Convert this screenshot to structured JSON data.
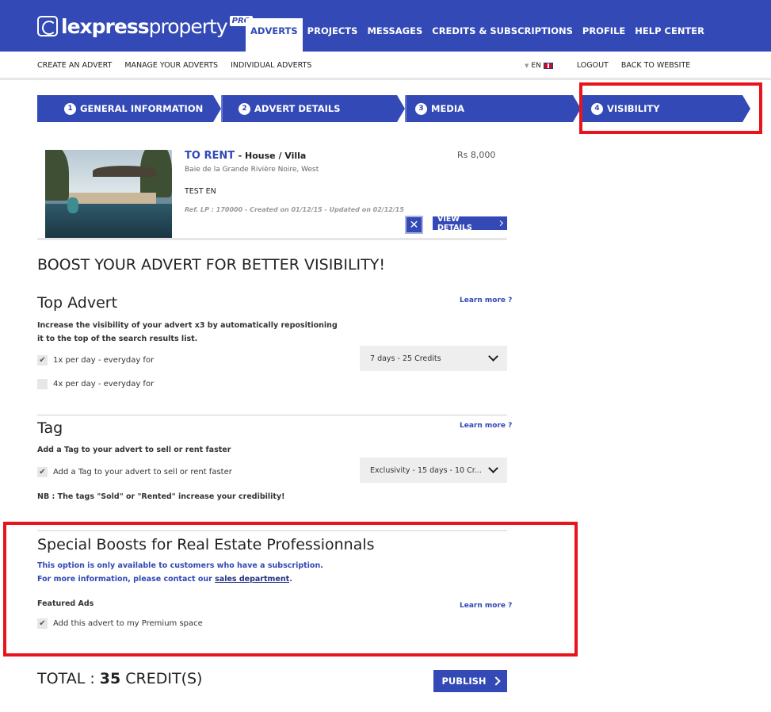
{
  "brand": {
    "logo_bold": "lexpress",
    "logo_light": "property",
    "logo_badge": "PRO"
  },
  "main_nav": [
    {
      "label": "ADVERTS",
      "active": true
    },
    {
      "label": "PROJECTS",
      "active": false
    },
    {
      "label": "MESSAGES",
      "active": false
    },
    {
      "label": "CREDITS & SUBSCRIPTIONS",
      "active": false
    },
    {
      "label": "PROFILE",
      "active": false
    },
    {
      "label": "HELP CENTER",
      "active": false
    }
  ],
  "sub_nav": {
    "left": [
      "CREATE AN ADVERT",
      "MANAGE YOUR ADVERTS",
      "INDIVIDUAL ADVERTS"
    ],
    "lang": "EN",
    "right": [
      "LOGOUT",
      "BACK TO WEBSITE"
    ]
  },
  "steps": [
    {
      "num": "1",
      "label": "GENERAL INFORMATION"
    },
    {
      "num": "2",
      "label": "ADVERT DETAILS"
    },
    {
      "num": "3",
      "label": "MEDIA"
    },
    {
      "num": "4",
      "label": "VISIBILITY"
    }
  ],
  "listing": {
    "transaction": "TO RENT",
    "kind": "- House / Villa",
    "location": "Baie de la Grande Rivière Noire, West",
    "title": "TEST EN",
    "ref": "Ref. LP : 170000 - Created on 01/12/15 - Updated on 02/12/15",
    "price": "Rs 8,000",
    "delete_glyph": "✕",
    "view_label": "VIEW DETAILS"
  },
  "boost_heading": "BOOST YOUR ADVERT FOR BETTER VISIBILITY!",
  "top_advert": {
    "title": "Top Advert",
    "learn_more": "Learn more ?",
    "desc_line1": "Increase the visibility of your advert x3 by automatically repositioning",
    "desc_line2": "it to the top of the search results list.",
    "opt1": {
      "label": "1x per day - everyday for",
      "checked": true
    },
    "opt2": {
      "label": "4x per day - everyday for",
      "checked": false
    },
    "select_value": "7 days - 25 Credits"
  },
  "tag": {
    "title": "Tag",
    "learn_more": "Learn more ?",
    "desc": "Add a Tag to your advert to sell or rent faster",
    "opt1": {
      "label": "Add a Tag to your advert to sell or rent faster",
      "checked": true
    },
    "select_value": "Exclusivity - 15 days - 10 Cr...",
    "note": "NB : The tags \"Sold\" or \"Rented\" increase your credibility!"
  },
  "special": {
    "title": "Special Boosts for Real Estate Professionnals",
    "note_line1": "This option is only available to customers who have a subscription.",
    "note_line2_prefix": "For more information, please contact our ",
    "note_line2_link": "sales department",
    "note_line2_suffix": ".",
    "featured_label": "Featured Ads",
    "learn_more": "Learn more ?",
    "opt1": {
      "label": "Add this advert to my Premium space",
      "checked": true
    }
  },
  "total": {
    "prefix": "TOTAL : ",
    "amount": "35",
    "suffix": " CREDIT(S)"
  },
  "publish_label": "PUBLISH",
  "check_glyph": "✔",
  "colors": {
    "brand_blue": "#3249b6",
    "highlight_red": "#e8141b"
  }
}
